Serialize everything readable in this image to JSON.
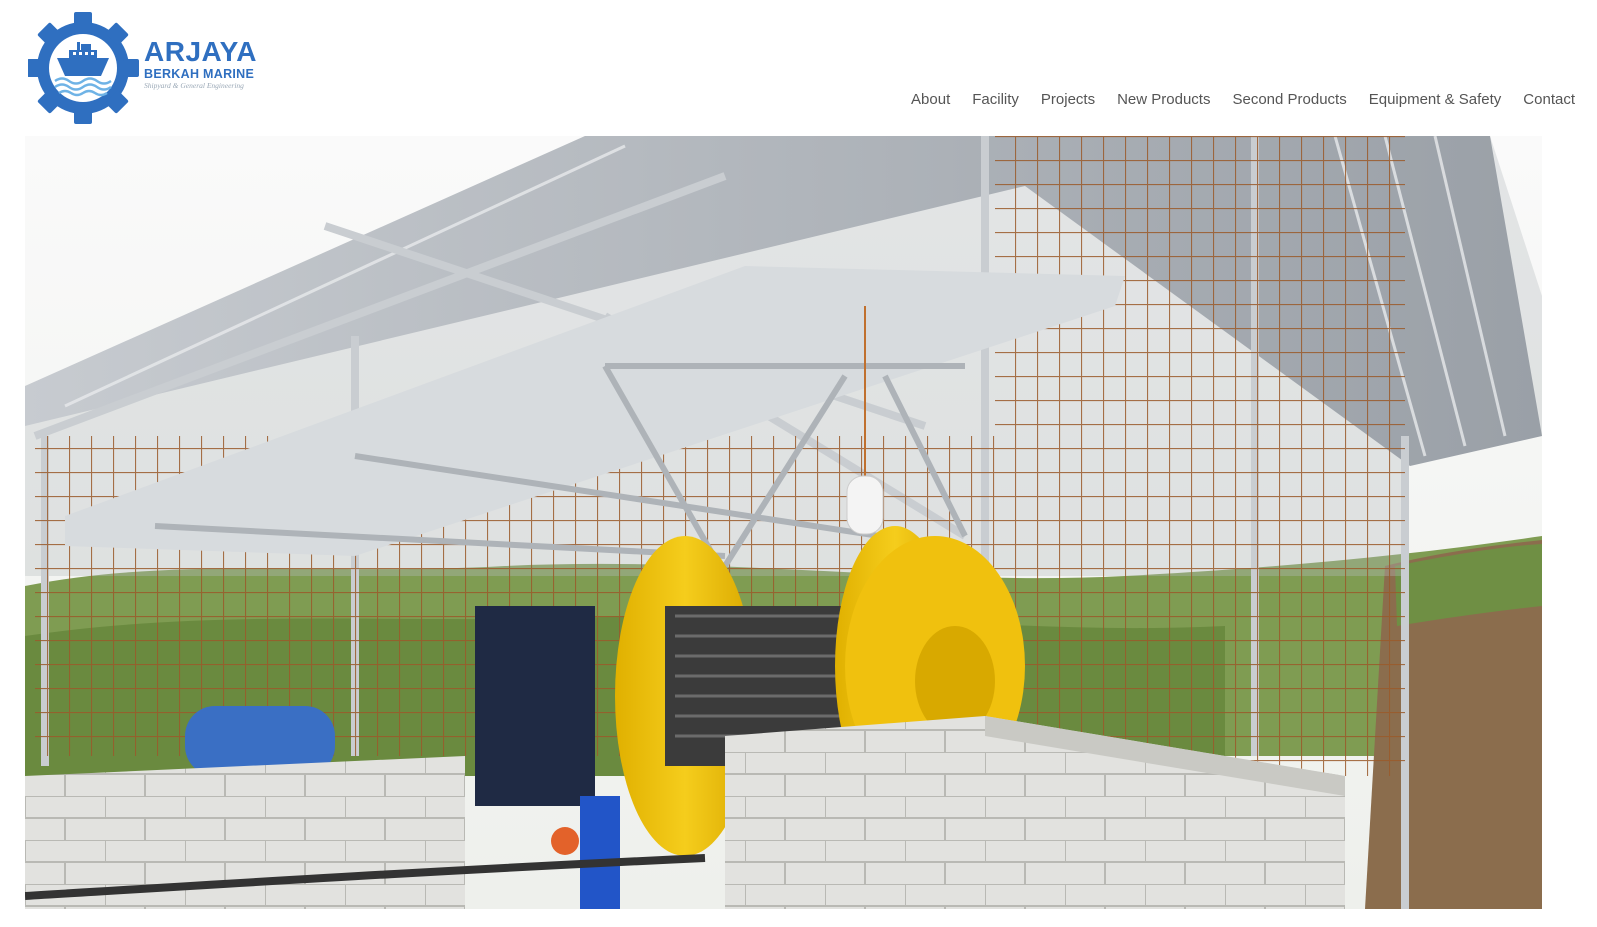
{
  "brand": {
    "name": "ARJAYA",
    "subtitle": "BERKAH MARINE",
    "tagline": "Shipyard & General Engineering",
    "primary_color": "#2f6fc0"
  },
  "nav": {
    "items": [
      {
        "label": "About"
      },
      {
        "label": "Facility"
      },
      {
        "label": "Projects"
      },
      {
        "label": "New Products"
      },
      {
        "label": "Second Products"
      },
      {
        "label": "Equipment & Safety"
      },
      {
        "label": "Contact"
      }
    ]
  },
  "hero": {
    "icon": "winch-shelter-photo"
  }
}
